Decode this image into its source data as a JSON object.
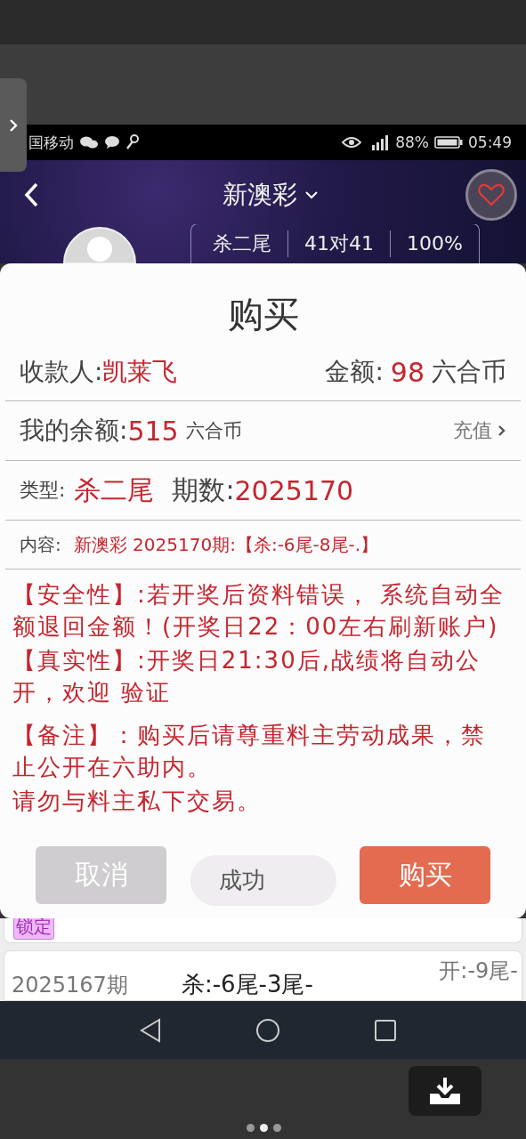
{
  "status_bar": {
    "carrier": "国移动",
    "battery": "88%",
    "time": "05:49"
  },
  "header": {
    "title": "新澳彩",
    "stats": [
      "杀二尾",
      "41对41",
      "100%"
    ]
  },
  "dialog": {
    "title": "购买",
    "recipient_label": "收款人:",
    "recipient": "凯莱飞",
    "amount_label": "金额:",
    "amount": "98",
    "amount_unit": "六合币",
    "balance_label": "我的余额:",
    "balance": "515",
    "balance_unit": "六合币",
    "recharge": "充值",
    "type_label": "类型:",
    "type": "杀二尾",
    "period_label": "期数:",
    "period": "2025170",
    "content_label": "内容:",
    "content": "新澳彩 2025170期:【杀:-6尾-8尾-.】",
    "notices": [
      {
        "text": "【安全性】:若开奖后资料错误， 系统自动全额退回金额！(开奖日22：00左右刷新账户)"
      },
      {
        "text": "【真实性】:开奖日21:30后,战绩将自动公开，欢迎 验证"
      },
      {
        "text": "【备注】：购买后请尊重料主劳动成果，禁止公开在六助内。"
      },
      {
        "text": "请勿与料主私下交易。"
      }
    ],
    "buttons": [
      {
        "label": "取消",
        "kind": "cancel"
      },
      {
        "label": "成功",
        "kind": "status"
      },
      {
        "label": "购买",
        "kind": "primary"
      }
    ]
  },
  "list": [
    {
      "badge": "锁定"
    },
    {
      "period": "2025167期",
      "kill": "杀:-6尾-3尾-",
      "open": "开:-9尾-"
    }
  ],
  "pager": [
    {
      "selected": false
    },
    {
      "selected": true
    },
    {
      "selected": false
    }
  ]
}
